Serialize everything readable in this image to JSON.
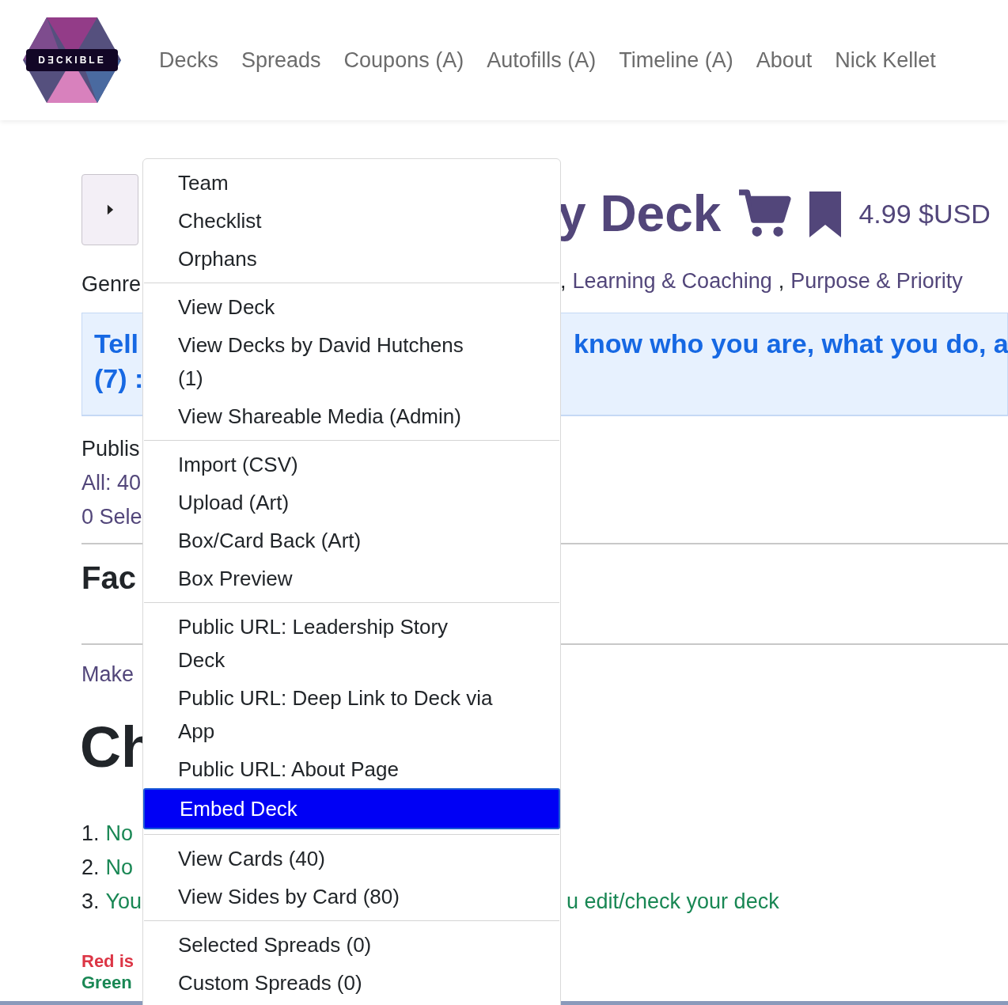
{
  "header": {
    "logo_text": "D∃CKIBLE",
    "nav": [
      "Decks",
      "Spreads",
      "Coupons (A)",
      "Autofills (A)",
      "Timeline (A)",
      "About",
      "Nick Kellet"
    ]
  },
  "deck": {
    "title": "y Deck",
    "price": "4.99 $USD",
    "genre_label": "Genre",
    "genre_separator": ",",
    "genres": [
      "Learning & Coaching",
      "Purpose & Priority"
    ],
    "genre_joiner": ",",
    "banner_left": [
      "Tell",
      "(7) :"
    ],
    "banner_right": "know who you are, what you do, a",
    "published_label": "Publis",
    "all_link": "All: 40",
    "selected_link": "0 Sele",
    "faces_heading": "Fac",
    "make_link": "Make",
    "checklist_heading": "Ch",
    "checklist": [
      {
        "number": "1.",
        "text": "No"
      },
      {
        "number": "2.",
        "text": "No"
      },
      {
        "number": "3.",
        "text": "You",
        "tail": "u edit/check your deck"
      }
    ],
    "legend": [
      {
        "kind": "red",
        "text": "Red is"
      },
      {
        "kind": "green",
        "text": "Green"
      }
    ]
  },
  "menu": {
    "groups": [
      [
        {
          "lines": [
            "Team"
          ],
          "selected": false
        },
        {
          "lines": [
            "Checklist"
          ],
          "selected": false
        },
        {
          "lines": [
            "Orphans"
          ],
          "selected": false
        }
      ],
      [
        {
          "lines": [
            "View Deck"
          ],
          "selected": false
        },
        {
          "lines": [
            "View Decks by David Hutchens",
            "(1)"
          ],
          "selected": false
        },
        {
          "lines": [
            "View Shareable Media (Admin)"
          ],
          "selected": false
        }
      ],
      [
        {
          "lines": [
            "Import (CSV)"
          ],
          "selected": false
        },
        {
          "lines": [
            "Upload (Art)"
          ],
          "selected": false
        },
        {
          "lines": [
            "Box/Card Back (Art)"
          ],
          "selected": false
        },
        {
          "lines": [
            "Box Preview"
          ],
          "selected": false
        }
      ],
      [
        {
          "lines": [
            "Public URL: Leadership Story",
            "Deck"
          ],
          "selected": false
        },
        {
          "lines": [
            "Public URL: Deep Link to Deck via",
            "App"
          ],
          "selected": false
        },
        {
          "lines": [
            "Public URL: About Page"
          ],
          "selected": false
        },
        {
          "lines": [
            "Embed Deck"
          ],
          "selected": true
        }
      ],
      [
        {
          "lines": [
            "View Cards (40)"
          ],
          "selected": false
        },
        {
          "lines": [
            "View Sides by Card (80)"
          ],
          "selected": false
        }
      ],
      [
        {
          "lines": [
            "Selected Spreads (0)"
          ],
          "selected": false
        },
        {
          "lines": [
            "Custom Spreads (0)"
          ],
          "selected": false
        }
      ]
    ]
  }
}
